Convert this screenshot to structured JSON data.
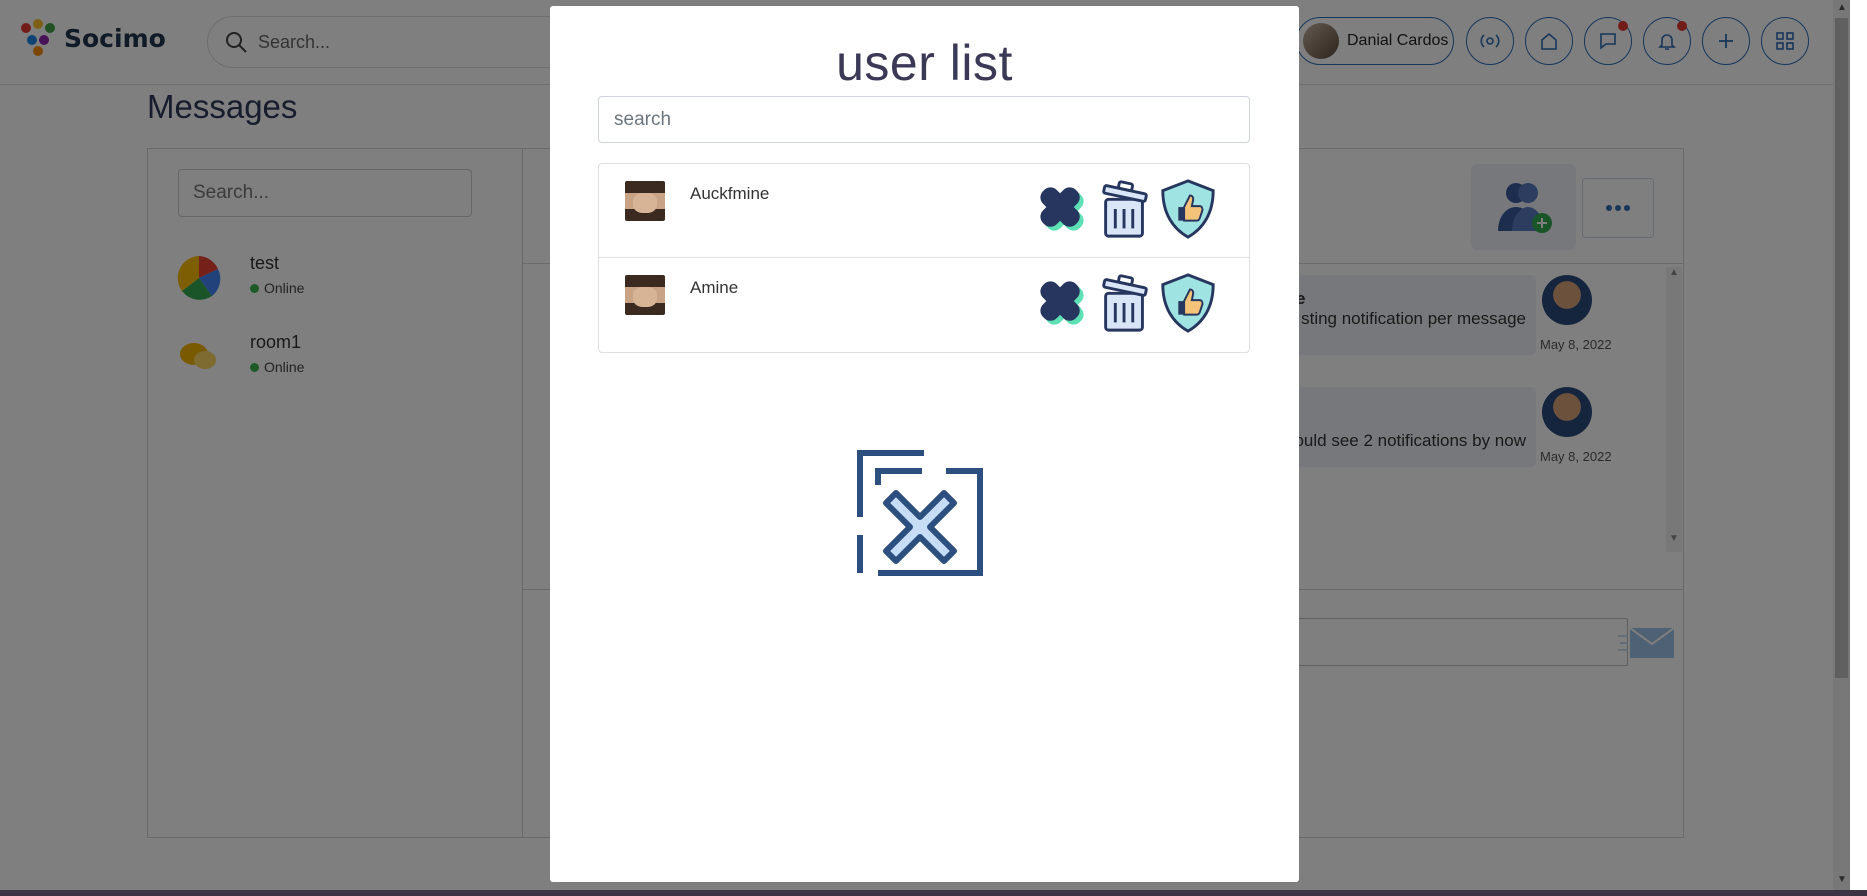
{
  "app": {
    "brand": "Socimo",
    "search_placeholder": "Search...",
    "profile_name": "Danial Cardos",
    "top_icons": [
      "broadcast-icon",
      "home-icon",
      "chat-icon",
      "bell-icon",
      "plus-icon",
      "grid-icon"
    ]
  },
  "messages_page": {
    "title": "Messages",
    "room_search_placeholder": "Search...",
    "rooms": [
      {
        "name": "test",
        "status": "Online"
      },
      {
        "name": "room1",
        "status": "Online"
      }
    ],
    "chat": {
      "messages": [
        {
          "fragment_bold": "e",
          "text": "sting notification per message",
          "date": "May 8, 2022"
        },
        {
          "text": "ould see 2 notifications by now",
          "date": "May 8, 2022"
        }
      ]
    }
  },
  "modal": {
    "title": "user list",
    "search_placeholder": "search",
    "users": [
      {
        "name": "Auckfmine"
      },
      {
        "name": "Amine"
      }
    ]
  },
  "colors": {
    "accent": "#2e6db4",
    "online": "#3bb54a",
    "icon_dark": "#27365e",
    "icon_mint": "#5ee0b5",
    "icon_shield": "#9fe3e3",
    "icon_thumb": "#f3c37a"
  }
}
